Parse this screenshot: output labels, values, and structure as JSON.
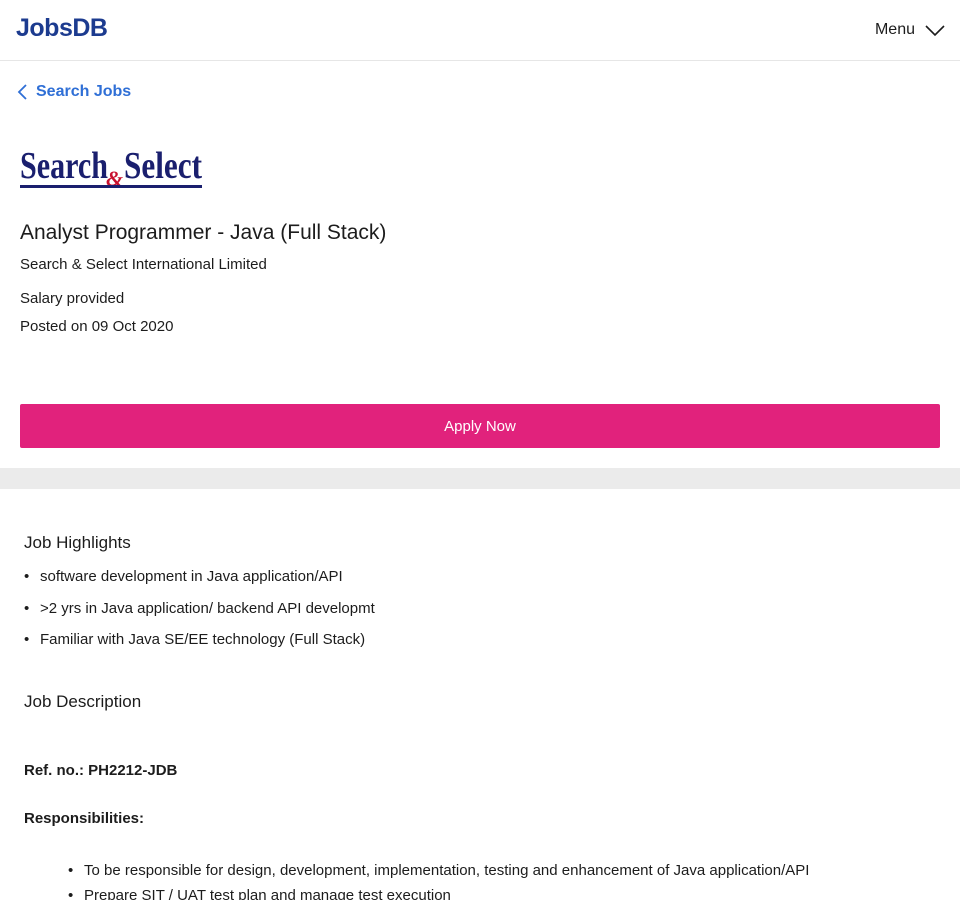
{
  "header": {
    "logo_text": "JobsDB",
    "menu_label": "Menu"
  },
  "nav": {
    "back_label": "Search Jobs"
  },
  "job": {
    "company_logo_text": "Search&Select",
    "title": "Analyst Programmer - Java (Full Stack)",
    "company": "Search & Select International Limited",
    "salary": "Salary provided",
    "posted": "Posted on 09 Oct 2020",
    "apply_label": "Apply Now"
  },
  "highlights": {
    "heading": "Job Highlights",
    "items": [
      "software development in Java application/API",
      ">2 yrs in Java application/ backend API developmt",
      "Familiar with Java SE/EE technology (Full Stack)"
    ]
  },
  "description": {
    "heading": "Job Description",
    "ref": "Ref. no.: PH2212-JDB",
    "responsibilities_heading": "Responsibilities:",
    "responsibilities": [
      "To be responsible for design, development, implementation, testing and enhancement of Java application/API",
      "Prepare SIT / UAT test plan and manage test execution"
    ]
  },
  "colors": {
    "brand": "#1c3b8f",
    "link": "#2f6fd6",
    "apply": "#e1227c",
    "logo_navy": "#1a1f6e",
    "logo_red": "#c8102e"
  },
  "icons": {
    "menu": "chevron-down-icon",
    "back": "chevron-left-icon"
  }
}
